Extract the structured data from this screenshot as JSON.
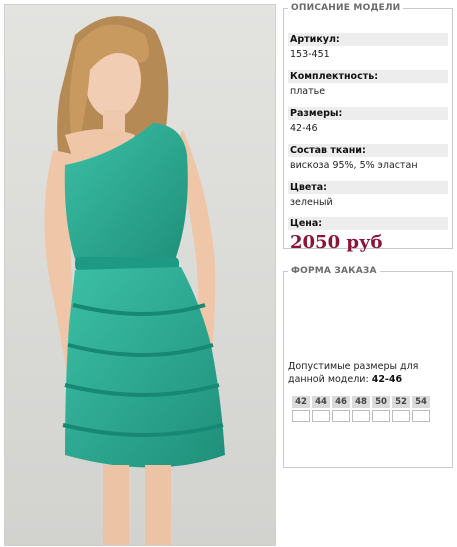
{
  "colors": {
    "dress": "#2aa48d",
    "price": "#8a1538"
  },
  "description": {
    "legend": "ОПИСАНИЕ МОДЕЛИ",
    "fields": [
      {
        "label": "Артикул:",
        "value": "153-451"
      },
      {
        "label": "Комплектность:",
        "value": "платье"
      },
      {
        "label": "Размеры:",
        "value": "42-46"
      },
      {
        "label": "Состав ткани:",
        "value": "вискоза 95%, 5% эластан"
      },
      {
        "label": "Цвета:",
        "value": "зеленый"
      },
      {
        "label": "Цена:",
        "value": ""
      }
    ],
    "price": "2050 руб"
  },
  "order": {
    "legend": "ФОРМА ЗАКАЗА",
    "allowed_text": "Допустимые размеры для данной модели:",
    "allowed_sizes": "42-46",
    "size_columns": [
      "42",
      "44",
      "46",
      "48",
      "50",
      "52",
      "54"
    ]
  }
}
